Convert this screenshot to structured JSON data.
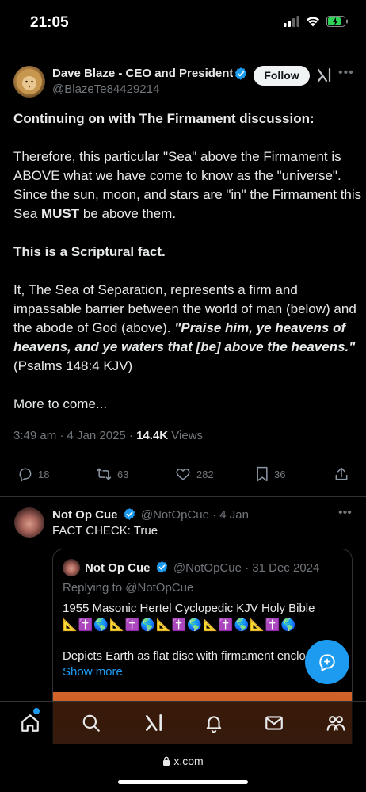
{
  "status_bar": {
    "time": "21:05"
  },
  "post": {
    "author_name": "Dave Blaze - CEO and President",
    "author_handle": "@BlazeTe84429214",
    "follow_label": "Follow",
    "heading": "Continuing on with The Firmament discussion:",
    "para1_a": "Therefore, this particular \"Sea\" above the Firmament is ABOVE what we have come to know as the \"universe\". Since the sun, moon, and stars are \"in\" the Firmament this Sea ",
    "para1_bold": "MUST",
    "para1_b": " be above them.",
    "para2": "This is a Scriptural fact.",
    "para3_a": "It, The Sea of Separation, represents a firm and impassable barrier between the world of man (below) and the abode of God (above). ",
    "para3_quote": "\"Praise him, ye heavens of heavens, and ye waters that [be] above the heavens.\"",
    "para3_b": " (Psalms 148:4 KJV)",
    "para4": "More to come...",
    "timestamp": "3:49 am · 4 Jan 2025 · ",
    "views_count": "14.4K",
    "views_label": " Views",
    "replies": "18",
    "reposts": "63",
    "likes": "282",
    "bookmarks": "36"
  },
  "reply": {
    "author_name": "Not Op Cue",
    "author_handle": "@NotOpCue",
    "date": " · 4 Jan",
    "text": "FACT CHECK: True",
    "quote": {
      "author_name": "Not Op Cue",
      "author_handle": "@NotOpCue",
      "date": " · 31 Dec 2024",
      "replying_to": "Replying to @NotOpCue",
      "text": "1955 Masonic Hertel Cyclopedic KJV Holy Bible",
      "emojis": "📐✝️🌎📐✝️🌎📐✝️🌎📐✝️🌎📐✝️🌎",
      "description": "Depicts Earth as flat disc with firmament enclosi...",
      "show_more": "Show more"
    }
  },
  "url_bar": {
    "domain": "x.com"
  },
  "colors": {
    "accent": "#1d9bf0",
    "background": "#000000",
    "muted": "#71767b"
  }
}
